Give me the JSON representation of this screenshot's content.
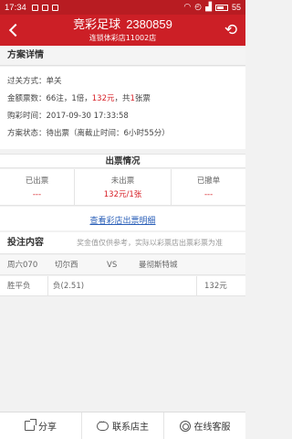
{
  "status_bar": {
    "time": "17:34",
    "battery": "55"
  },
  "header": {
    "title": "竞彩足球",
    "order_no": "2380859",
    "subtitle": "连锁体彩店11002店"
  },
  "plan": {
    "section_title": "方案详情",
    "pass_type_label": "过关方式：",
    "pass_type_value": "单关",
    "amount_label": "金额票数：",
    "amount_prefix": "66注，1倍，",
    "amount_money": "132元",
    "amount_mid": "，共",
    "amount_count": "1",
    "amount_suffix": "张票",
    "buy_time_label": "购彩时间：",
    "buy_time_value": "2017-09-30 17:33:58",
    "status_label": "方案状态：",
    "status_value": "待出票（离截止时间：6小时55分）"
  },
  "issue": {
    "title": "出票情况",
    "cells": [
      {
        "label": "已出票",
        "value": "---"
      },
      {
        "label": "未出票",
        "value": "132元/1张"
      },
      {
        "label": "已撤单",
        "value": "---"
      }
    ],
    "store_link": "查看彩店出票明细"
  },
  "bet": {
    "title": "投注内容",
    "note": "奖金值仅供参考，实际以彩票店出票彩票为准",
    "match": {
      "no": "周六070",
      "home": "切尔西",
      "vs": "VS",
      "away": "曼彻斯特城"
    },
    "pick": {
      "play": "胜平负",
      "selection": "负(2.51)",
      "amount": "132元"
    }
  },
  "bottom_bar": {
    "share": "分享",
    "contact": "联系店主",
    "service": "在线客服"
  },
  "colors": {
    "header_red": "#cc1f26",
    "accent_red": "#d71f26",
    "link_blue": "#2a5fb8"
  }
}
